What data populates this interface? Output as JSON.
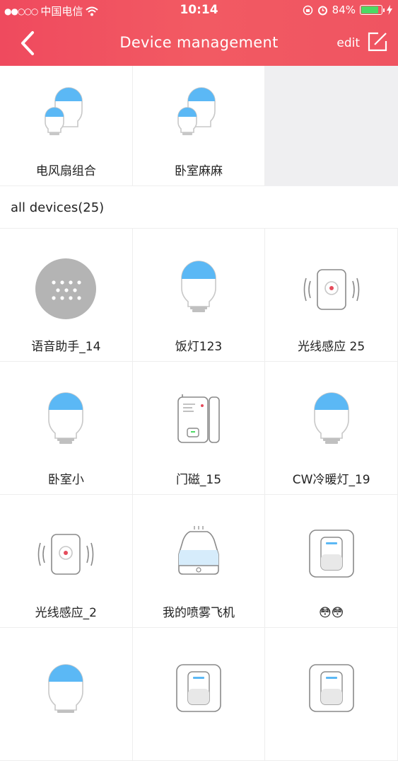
{
  "status_bar": {
    "signal": "●●○○○",
    "carrier": "中国电信",
    "time": "10:14",
    "battery": "84%",
    "battery_level": 0.84
  },
  "nav": {
    "title": "Device management",
    "edit_label": "edit"
  },
  "groups": [
    {
      "label": "电风扇组合",
      "icon": "bulb-group-icon"
    },
    {
      "label": "卧室麻麻",
      "icon": "bulb-group-icon"
    }
  ],
  "section": {
    "title": "all devices(25)"
  },
  "devices": [
    {
      "label": "语音助手_14",
      "icon": "voice-assistant-icon"
    },
    {
      "label": "饭灯123",
      "icon": "bulb-icon"
    },
    {
      "label": "光线感应 25",
      "icon": "light-sensor-icon"
    },
    {
      "label": "卧室小",
      "icon": "bulb-icon"
    },
    {
      "label": "门磁_15",
      "icon": "door-sensor-icon"
    },
    {
      "label": "CW冷暖灯_19",
      "icon": "bulb-icon"
    },
    {
      "label": "光线感应_2",
      "icon": "light-sensor-icon"
    },
    {
      "label": "我的喷雾飞机",
      "icon": "humidifier-icon"
    },
    {
      "label": "😳😳",
      "icon": "wall-switch-icon"
    },
    {
      "label": "",
      "icon": "bulb-icon"
    },
    {
      "label": "",
      "icon": "wall-switch-icon"
    },
    {
      "label": "",
      "icon": "wall-switch-icon"
    }
  ],
  "colors": {
    "header": "#ef4a5e",
    "bulb_cap": "#5bb8f5",
    "battery": "#4cd964"
  }
}
